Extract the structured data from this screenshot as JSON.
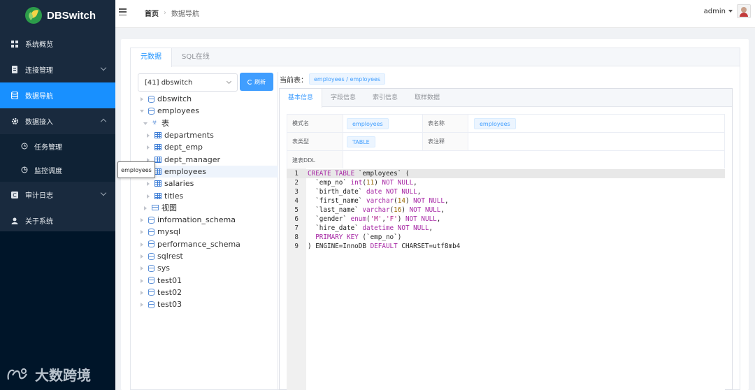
{
  "app": {
    "name": "DBSwitch"
  },
  "sidebar": {
    "items": [
      {
        "label": "系统概览",
        "icon": "dashboard-icon"
      },
      {
        "label": "连接管理",
        "icon": "connection-icon"
      },
      {
        "label": "数据导航",
        "icon": "database-icon"
      },
      {
        "label": "数据接入",
        "icon": "gear-icon"
      },
      {
        "label": "任务管理",
        "icon": "task-icon"
      },
      {
        "label": "监控调度",
        "icon": "clock-icon"
      },
      {
        "label": "审计日志",
        "icon": "audit-icon"
      },
      {
        "label": "关于系统",
        "icon": "user-icon"
      }
    ],
    "active_index": 2,
    "accent": "#1890ff"
  },
  "header": {
    "breadcrumb_home": "首页",
    "breadcrumb_current": "数据导航",
    "user": "admin"
  },
  "outer_tabs": [
    "元数据",
    "SQL在线"
  ],
  "tree": {
    "select_value": "[41] dbswitch",
    "refresh_label": "刷新",
    "nodes": [
      "dbswitch",
      "employees",
      "表",
      "departments",
      "dept_emp",
      "dept_manager",
      "employees",
      "salaries",
      "titles",
      "视图",
      "information_schema",
      "mysql",
      "performance_schema",
      "sqlrest",
      "sys",
      "test01",
      "test02",
      "test03"
    ],
    "tooltip": "employees"
  },
  "detail": {
    "current_label": "当前表：",
    "current_value": "employees / employees",
    "tabs": [
      "基本信息",
      "字段信息",
      "索引信息",
      "取样数据"
    ],
    "schema_label": "模式名",
    "schema_value": "employees",
    "table_name_label": "表名称",
    "table_name_value": "employees",
    "table_type_label": "表类型",
    "table_type_value": "TABLE",
    "table_comment_label": "表注释",
    "ddl_label": "建表DDL",
    "ddl_lines": [
      "CREATE TABLE `employees` (",
      "  `emp_no` int(11) NOT NULL,",
      "  `birth_date` date NOT NULL,",
      "  `first_name` varchar(14) NOT NULL,",
      "  `last_name` varchar(16) NOT NULL,",
      "  `gender` enum('M','F') NOT NULL,",
      "  `hire_date` datetime NOT NULL,",
      "  PRIMARY KEY (`emp_no`)",
      ") ENGINE=InnoDB DEFAULT CHARSET=utf8mb4"
    ]
  },
  "watermark": "大数跨境"
}
